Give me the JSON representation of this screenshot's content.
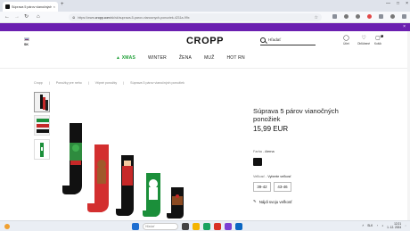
{
  "browser": {
    "tab_title": "Súprava 5 párov vianočných p",
    "tab_close": "×",
    "new_tab": "+",
    "url_prefix": "https://www.",
    "url_domain": "cropp.com",
    "url_path": "/sk/sk/suprava-5-parov-vianocnych-ponoziek-4211a-99x",
    "window_controls": [
      "—",
      "□",
      "×"
    ]
  },
  "header": {
    "lang": "SK",
    "logo": "CROPP",
    "search_placeholder": "Hľadať",
    "account_label": "Účet",
    "wishlist_label": "Obľúbené",
    "cart_label": "Košík",
    "cart_count": "0"
  },
  "menu": [
    "XMAS",
    "WINTER",
    "ŽENA",
    "MUŽ",
    "HOT RN"
  ],
  "breadcrumb": [
    "Cropp",
    "Ponožky pre neho",
    "Vtipné ponožky",
    "Súprava 5 párov vianočných ponožiek"
  ],
  "product": {
    "title": "Súprava 5 párov vianočných ponožiek",
    "price": "15,99 EUR",
    "color_label": "Farba - ",
    "color_value": "čierna",
    "size_label": "Veľkosť - ",
    "size_value": "Vyberte veľkosť",
    "sizes": [
      "39-42",
      "43-46"
    ],
    "fit_link": "Nájdi svoju veľkosť"
  },
  "taskbar": {
    "search_placeholder": "Hľadať",
    "lang": "SLK",
    "time": "12:21",
    "date": "1. 12. 2024"
  },
  "colors": {
    "promo": "#6b1fb0",
    "xmas": "#20a038"
  }
}
